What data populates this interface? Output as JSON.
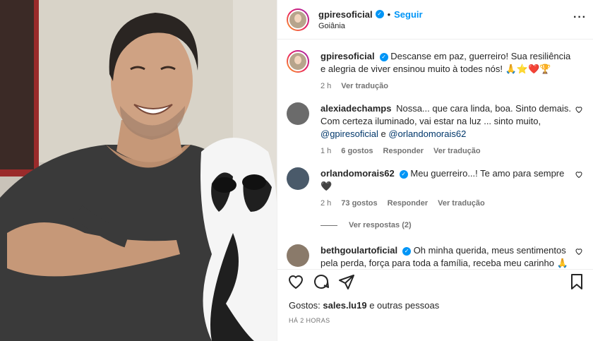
{
  "post": {
    "username": "gpiresoficial",
    "follow_label": "Seguir",
    "location": "Goiânia",
    "options_icon": "more-horizontal-icon"
  },
  "caption": {
    "username": "gpiresoficial",
    "text": "Descanse em paz, guerreiro! Sua resiliência e alegria de viver ensinou muito à todes nós! 🙏⭐❤️🏆",
    "time": "2 h",
    "translate_label": "Ver tradução"
  },
  "comments": [
    {
      "username": "alexiadechamps",
      "text": "Nossa... que cara linda, boa. Sinto demais. Com certeza iluminado, vai estar na luz ... sinto muito,",
      "mention1": "@gpiresoficial",
      "joiner": " e ",
      "mention2": "@orlandomorais62",
      "time": "1 h",
      "likes": "6 gostos",
      "reply_label": "Responder",
      "translate_label": "Ver tradução"
    },
    {
      "username": "orlandomorais62",
      "text": "Meu guerreiro...! Te amo para sempre 🖤",
      "time": "2 h",
      "likes": "73 gostos",
      "reply_label": "Responder",
      "translate_label": "Ver tradução",
      "replies_label": "Ver respostas (2)"
    },
    {
      "username": "bethgoulartoficial",
      "text": "Oh minha querida, meus sentimentos pela perda, força para toda a família, receba meu carinho 🙏"
    }
  ],
  "footer": {
    "likes_prefix": "Gostos:",
    "likes_user": "sales.lu19",
    "likes_suffix": "e outras pessoas",
    "timestamp": "HÁ 2 HORAS"
  },
  "colors": {
    "accent": "#0095f6",
    "muted": "#737373",
    "text": "#262626",
    "mention": "#00376b"
  }
}
